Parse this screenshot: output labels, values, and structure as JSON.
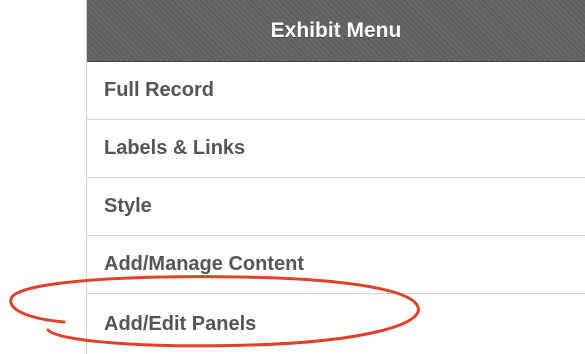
{
  "menu": {
    "title": "Exhibit Menu",
    "items": [
      {
        "label": "Full Record"
      },
      {
        "label": "Labels & Links"
      },
      {
        "label": "Style"
      },
      {
        "label": "Add/Manage Content"
      },
      {
        "label": "Add/Edit Panels"
      }
    ]
  },
  "colors": {
    "header_bg": "#626262",
    "item_text": "#555555",
    "highlight_circle": "#e0412a"
  },
  "annotation": {
    "highlighted_item": "Add/Edit Panels",
    "shape": "ellipse"
  }
}
